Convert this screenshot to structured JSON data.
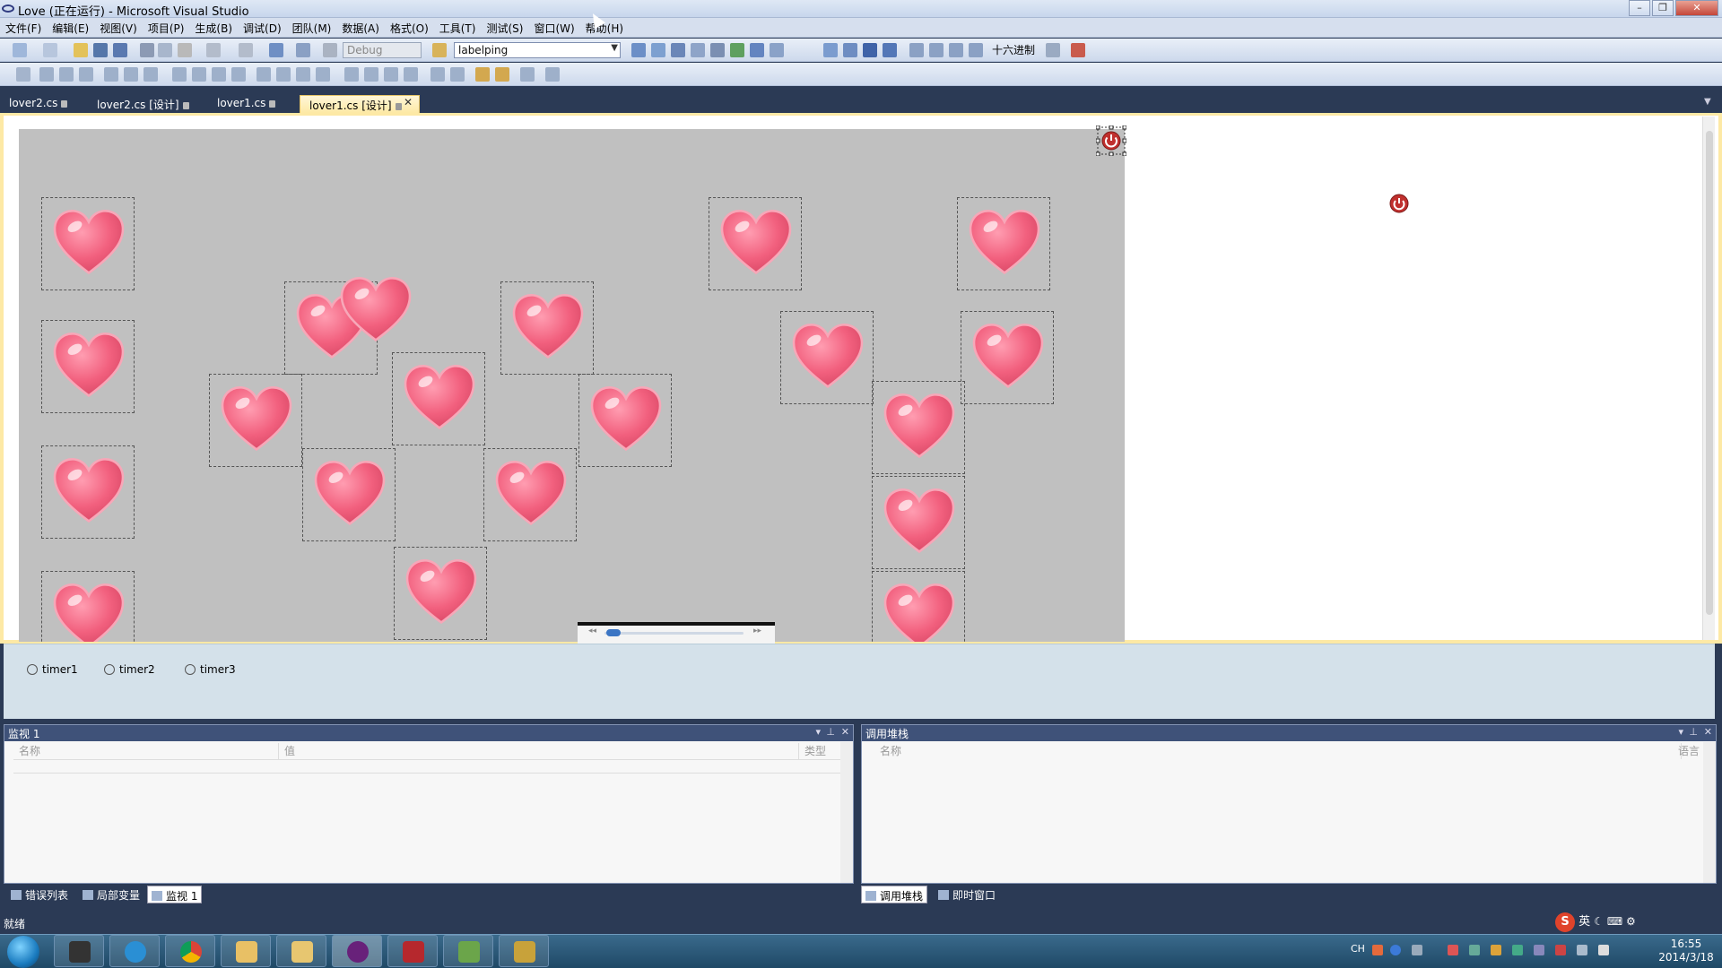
{
  "window": {
    "title": "Love (正在运行) - Microsoft Visual Studio"
  },
  "menu": [
    "文件(F)",
    "编辑(E)",
    "视图(V)",
    "项目(P)",
    "生成(B)",
    "调试(D)",
    "团队(M)",
    "数据(A)",
    "格式(O)",
    "工具(T)",
    "测试(S)",
    "窗口(W)",
    "帮助(H)"
  ],
  "toolbar": {
    "config": "Debug",
    "startup": "labelping",
    "hex_label": "十六进制"
  },
  "doc_tabs": [
    {
      "label": "lover2.cs",
      "active": false
    },
    {
      "label": "lover2.cs [设计]",
      "active": false
    },
    {
      "label": "lover1.cs",
      "active": false
    },
    {
      "label": "lover1.cs [设计]",
      "active": true
    }
  ],
  "designer": {
    "form_background": "#c0c0c0",
    "heart_color": "#f2607e",
    "picture_boxes": 26,
    "components": [
      "timer1",
      "timer2",
      "timer3"
    ]
  },
  "watch_panel": {
    "title": "监视 1",
    "columns": [
      "名称",
      "值",
      "类型"
    ]
  },
  "callstack_panel": {
    "title": "调用堆栈",
    "columns": [
      "名称",
      "语言"
    ]
  },
  "bottom_tabs_left": [
    "错误列表",
    "局部变量",
    "监视 1"
  ],
  "bottom_tabs_right": [
    "调用堆栈",
    "即时窗口"
  ],
  "status": {
    "text": "就绪"
  },
  "ime": {
    "label": "英"
  },
  "taskbar": {
    "lang": "CH",
    "time": "16:55",
    "date": "2014/3/18"
  }
}
